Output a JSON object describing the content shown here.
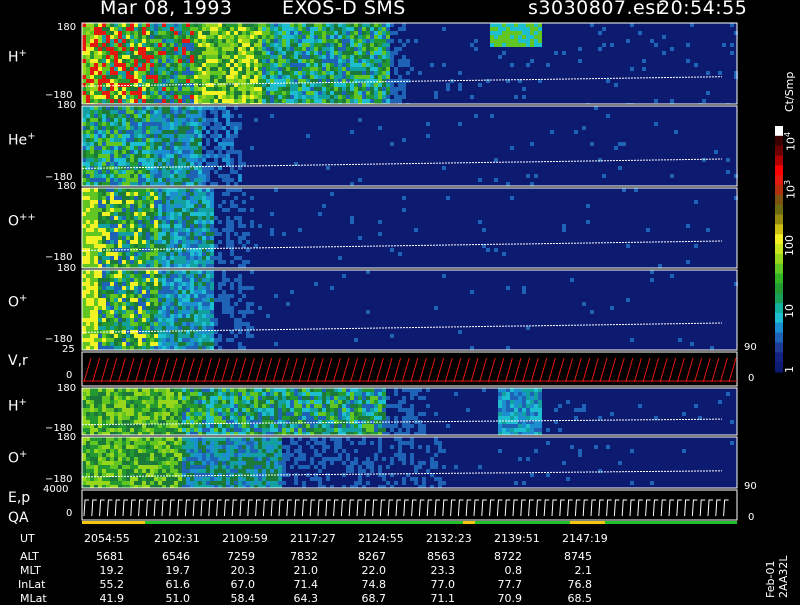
{
  "header": {
    "date": "Mar 08, 1993",
    "instrument": "EXOS-D SMS",
    "file": "s3030807.esr",
    "time": "20:54:55"
  },
  "panels": [
    {
      "species": "H",
      "charge": "+",
      "ymax": "180",
      "ymin": "−180"
    },
    {
      "species": "He",
      "charge": "+",
      "ymax": "180",
      "ymin": "−180"
    },
    {
      "species": "O",
      "charge": "++",
      "ymax": "180",
      "ymin": "−180"
    },
    {
      "species": "O",
      "charge": "+",
      "ymax": "180",
      "ymin": "−180"
    },
    {
      "species": "H",
      "charge": "+",
      "ymax": "180",
      "ymin": "−180"
    },
    {
      "species": "O",
      "charge": "+",
      "ymax": "180",
      "ymin": "−180"
    }
  ],
  "vr_panel": {
    "label": "V,r",
    "ymax": "25",
    "ymin": "0",
    "right_top": "90",
    "right_bottom": "0"
  },
  "ep_panel": {
    "label1": "E,p",
    "label2": "QA",
    "ymax": "4000",
    "ymin": "0",
    "right_top": "90",
    "right_bottom": "0"
  },
  "colorbar": {
    "unit": "Ct/Smp",
    "ticks": [
      "1",
      "10",
      "100",
      "10",
      "10"
    ],
    "tick_exponents": [
      "",
      "",
      "",
      "3",
      "4"
    ],
    "colors": [
      "#0c1a70",
      "#14237f",
      "#1c3c96",
      "#1f63b7",
      "#1b8fd0",
      "#1cbecf",
      "#13b0a0",
      "#1b9e55",
      "#229a31",
      "#32b227",
      "#61c621",
      "#97d71b",
      "#c9e71c",
      "#f3f224",
      "#cdbf14",
      "#968a10",
      "#6e6a11",
      "#7d5310",
      "#b0300e",
      "#e3180e",
      "#ff0000",
      "#b00000",
      "#6a0000",
      "#3b0000",
      "#ffffff"
    ]
  },
  "chart_data": {
    "type": "heatmap",
    "title": "Mar 08, 1993   EXOS-D SMS",
    "xlabel": "UT",
    "x": [
      "2054:55",
      "2102:31",
      "2109:59",
      "2117:27",
      "2124:55",
      "2132:23",
      "2139:51",
      "2147:19"
    ],
    "rows": [
      {
        "name": "ALT",
        "values": [
          "5681",
          "6546",
          "7259",
          "7832",
          "8267",
          "8563",
          "8722",
          "8745"
        ]
      },
      {
        "name": "MLT",
        "values": [
          "19.2",
          "19.7",
          "20.3",
          "21.0",
          "22.0",
          "23.3",
          "0.8",
          "2.1"
        ]
      },
      {
        "name": "InLat",
        "values": [
          "55.2",
          "61.6",
          "67.0",
          "71.4",
          "74.8",
          "77.0",
          "77.7",
          "76.8"
        ]
      },
      {
        "name": "MLat",
        "values": [
          "41.9",
          "51.0",
          "58.4",
          "64.3",
          "68.7",
          "71.1",
          "70.9",
          "68.5"
        ]
      }
    ],
    "ylim": [
      -180,
      180
    ],
    "colorscale": "log",
    "zlim": [
      1,
      10000
    ],
    "side_label": "Feb-01 2AA32L"
  }
}
